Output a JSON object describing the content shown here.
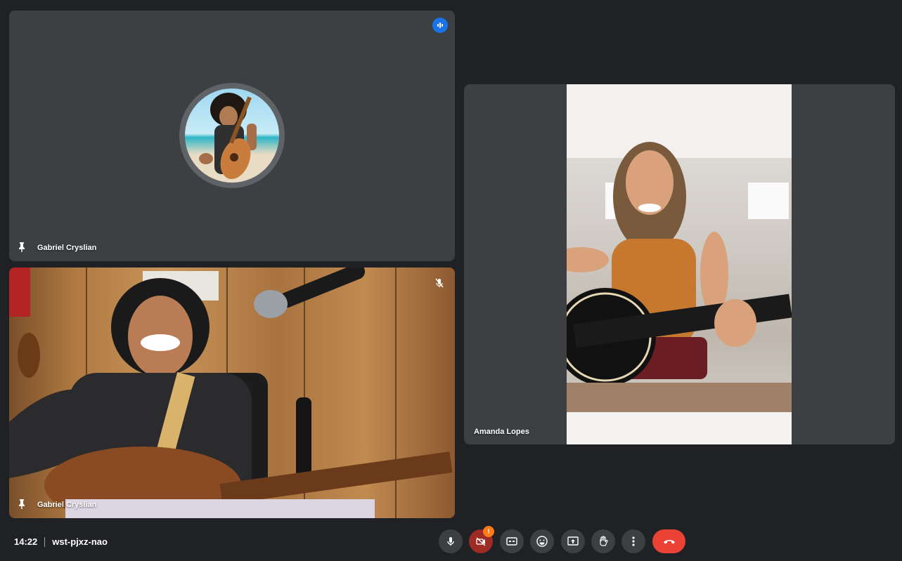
{
  "tiles": {
    "top": {
      "name": "Gabriel Cryslian"
    },
    "bottom": {
      "name": "Gabriel Cryslian"
    },
    "right": {
      "name": "Amanda Lopes"
    }
  },
  "bottom_bar": {
    "time": "14:22",
    "meeting_code": "wst-pjxz-nao",
    "camera_badge": "!",
    "controls": [
      "mic-icon",
      "camera-off-icon",
      "captions-icon",
      "emoji-icon",
      "present-icon",
      "raise-hand-icon",
      "more-options-icon",
      "end-call-icon"
    ]
  },
  "colors": {
    "background": "#202124",
    "tile": "#3c4043",
    "speaking": "#1a73e8",
    "end_call": "#ea4335",
    "camera_off": "#9e2b25",
    "badge": "#fa7b17"
  }
}
